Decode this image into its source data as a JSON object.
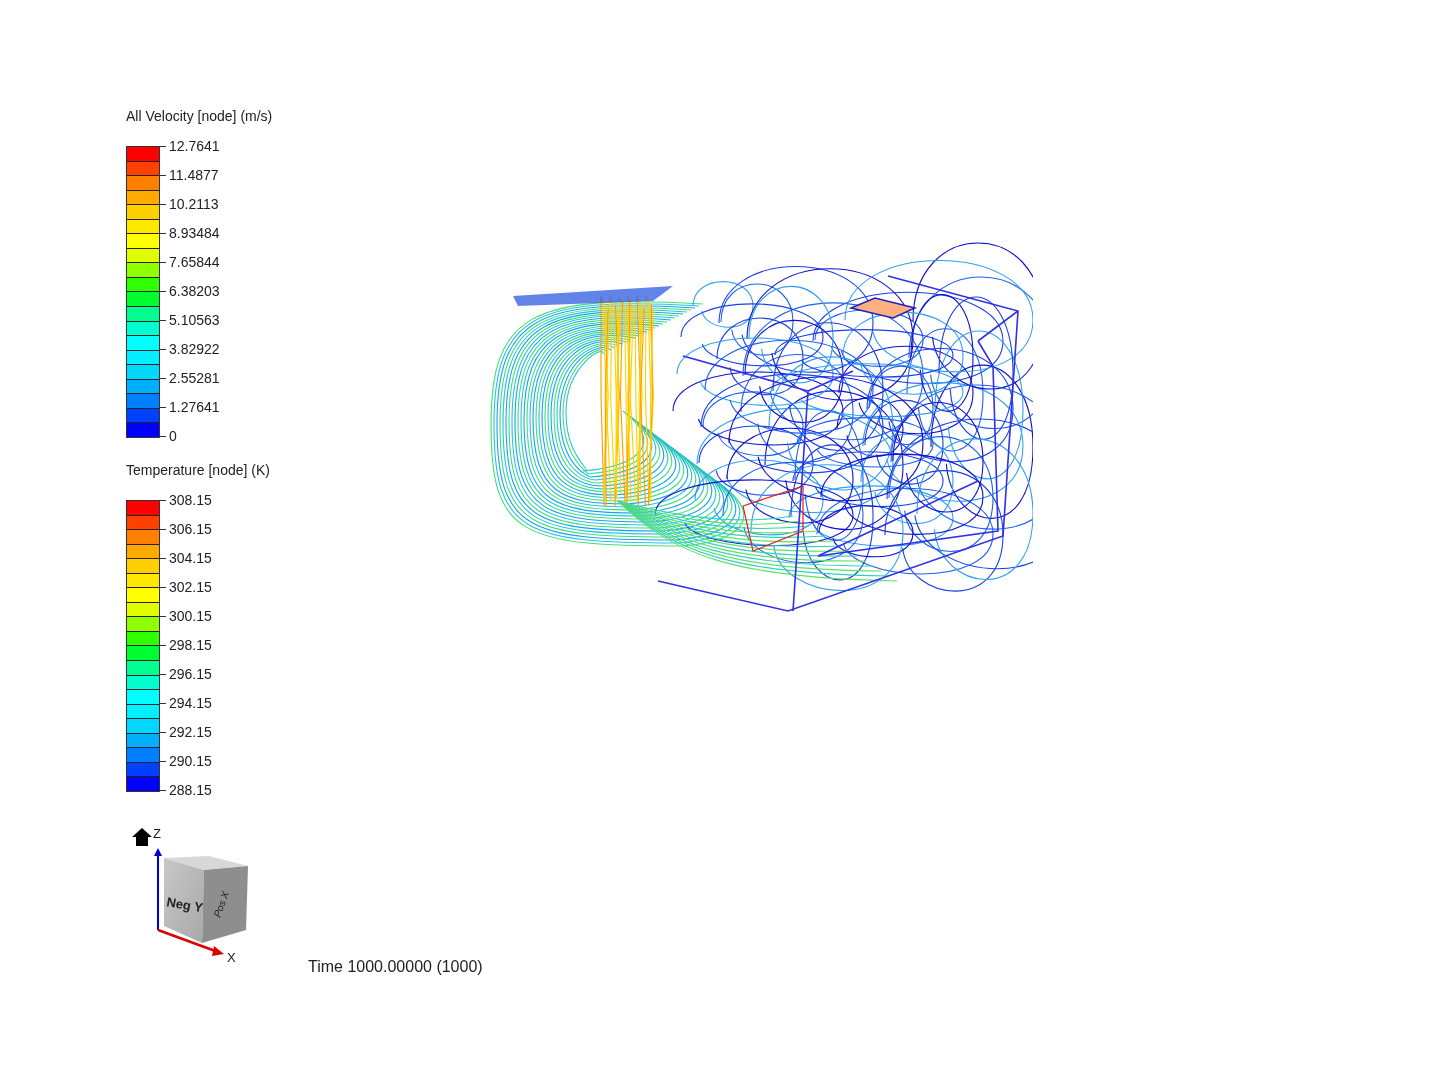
{
  "legends": [
    {
      "title": "All Velocity [node] (m/s)",
      "labels": [
        "12.7641",
        "11.4877",
        "10.2113",
        "8.93484",
        "7.65844",
        "6.38203",
        "5.10563",
        "3.82922",
        "2.55281",
        "1.27641",
        "0"
      ],
      "bands": [
        {
          "color": "#ff0000"
        },
        {
          "color": "#ff4000"
        },
        {
          "color": "#ff8000"
        },
        {
          "color": "#ffaa00"
        },
        {
          "color": "#ffd000"
        },
        {
          "color": "#ffe800"
        },
        {
          "color": "#ffff00"
        },
        {
          "color": "#e0ff00"
        },
        {
          "color": "#90ff00"
        },
        {
          "color": "#30ff00"
        },
        {
          "color": "#00ff30"
        },
        {
          "color": "#00ff90"
        },
        {
          "color": "#00ffd0"
        },
        {
          "color": "#00ffff"
        },
        {
          "color": "#00f0ff"
        },
        {
          "color": "#00d8ff"
        },
        {
          "color": "#00b0ff"
        },
        {
          "color": "#0080ff"
        },
        {
          "color": "#0040ff"
        },
        {
          "color": "#0000ff"
        }
      ]
    },
    {
      "title": "Temperature [node] (K)",
      "labels": [
        "308.15",
        "306.15",
        "304.15",
        "302.15",
        "300.15",
        "298.15",
        "296.15",
        "294.15",
        "292.15",
        "290.15",
        "288.15"
      ],
      "bands": [
        {
          "color": "#ff0000"
        },
        {
          "color": "#ff4000"
        },
        {
          "color": "#ff8000"
        },
        {
          "color": "#ffaa00"
        },
        {
          "color": "#ffd000"
        },
        {
          "color": "#ffe800"
        },
        {
          "color": "#ffff00"
        },
        {
          "color": "#e0ff00"
        },
        {
          "color": "#90ff00"
        },
        {
          "color": "#30ff00"
        },
        {
          "color": "#00ff30"
        },
        {
          "color": "#00ff90"
        },
        {
          "color": "#00ffd0"
        },
        {
          "color": "#00ffff"
        },
        {
          "color": "#00f0ff"
        },
        {
          "color": "#00d8ff"
        },
        {
          "color": "#00b0ff"
        },
        {
          "color": "#0080ff"
        },
        {
          "color": "#0040ff"
        },
        {
          "color": "#0000ff"
        }
      ]
    }
  ],
  "view_cube": {
    "z_axis": "Z",
    "x_axis": "X",
    "front_face": "Neg Y",
    "side_face": "Pos X"
  },
  "time": "Time 1000.00000 (1000)"
}
